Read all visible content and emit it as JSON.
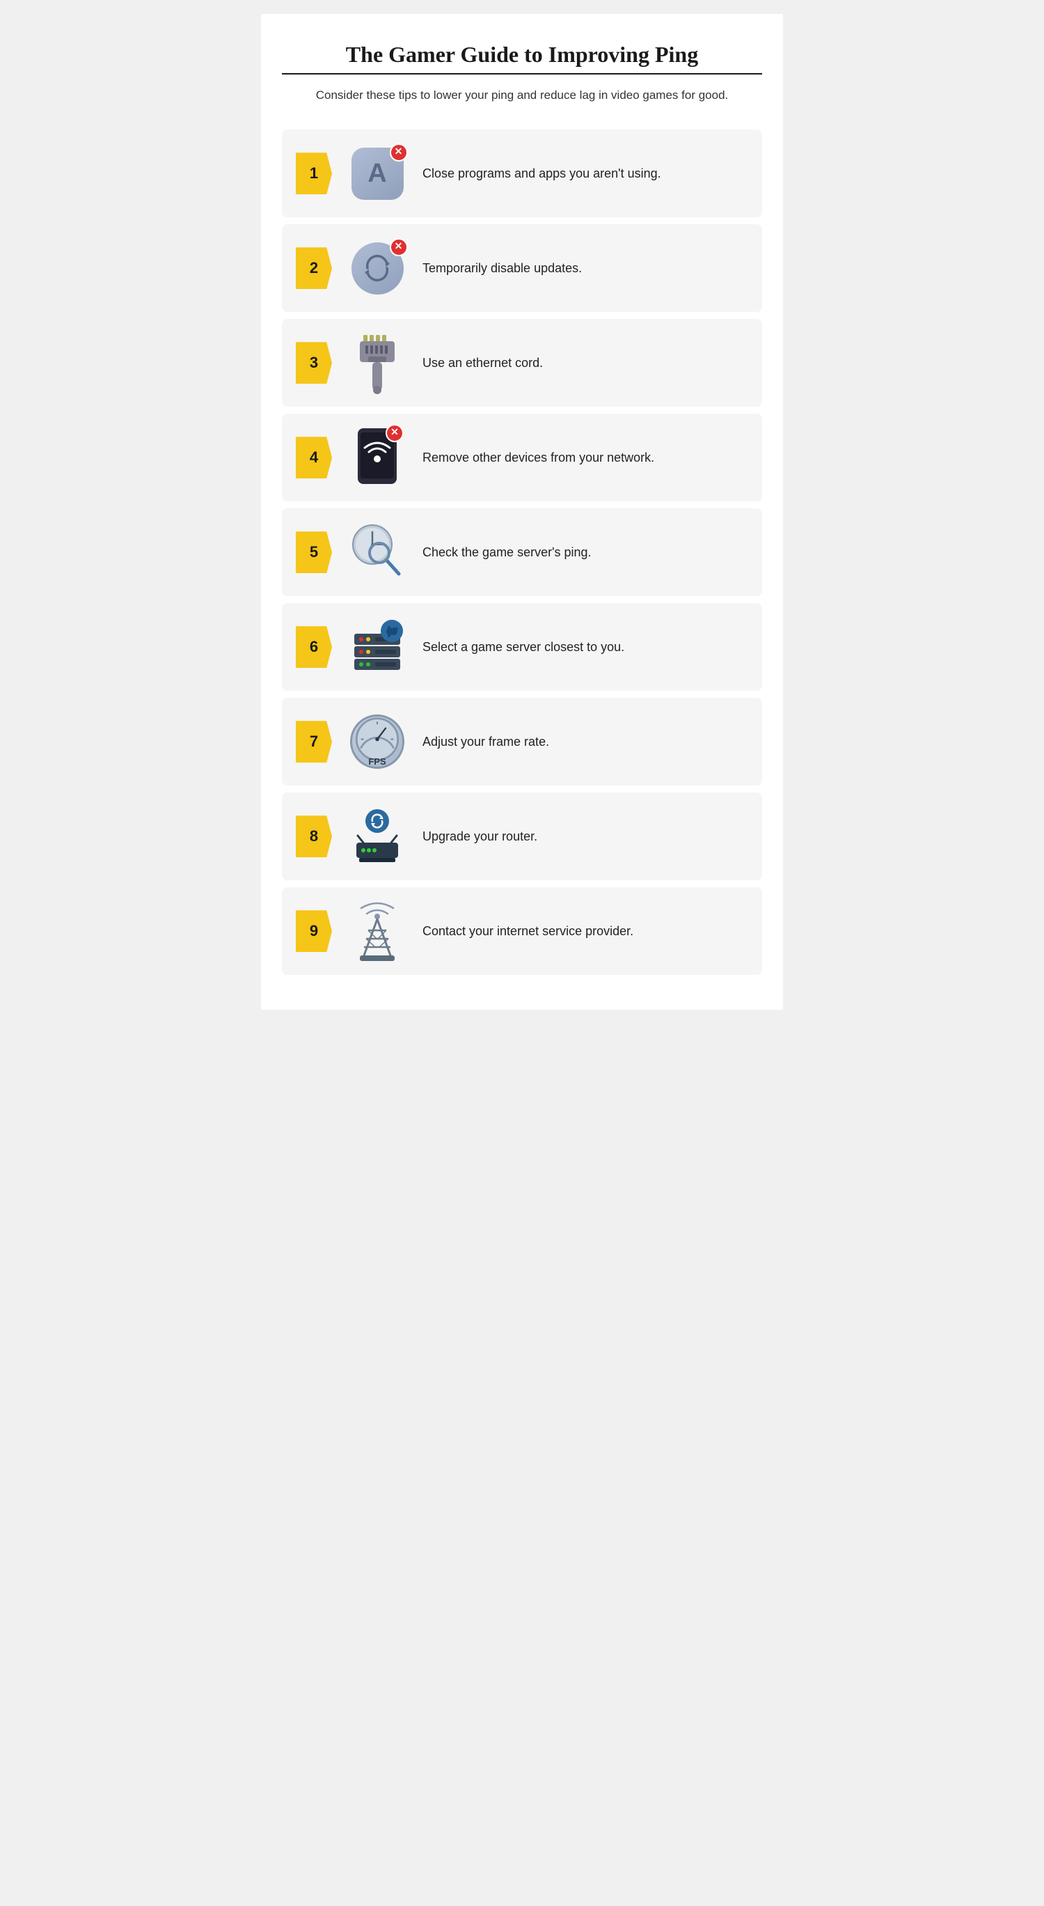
{
  "page": {
    "title": "The Gamer Guide to Improving Ping",
    "subtitle": "Consider these tips to lower your ping and reduce lag in video games for good.",
    "tips": [
      {
        "number": "1",
        "text": "Close programs and apps you aren't using.",
        "icon_type": "app"
      },
      {
        "number": "2",
        "text": "Temporarily disable updates.",
        "icon_type": "sync"
      },
      {
        "number": "3",
        "text": "Use an ethernet cord.",
        "icon_type": "ethernet"
      },
      {
        "number": "4",
        "text": "Remove other devices from your network.",
        "icon_type": "phone"
      },
      {
        "number": "5",
        "text": "Check the game server's ping.",
        "icon_type": "clockmag"
      },
      {
        "number": "6",
        "text": "Select a game server closest to you.",
        "icon_type": "server"
      },
      {
        "number": "7",
        "text": "Adjust your frame rate.",
        "icon_type": "fps"
      },
      {
        "number": "8",
        "text": "Upgrade your router.",
        "icon_type": "router"
      },
      {
        "number": "9",
        "text": "Contact your internet service provider.",
        "icon_type": "tower"
      }
    ]
  }
}
